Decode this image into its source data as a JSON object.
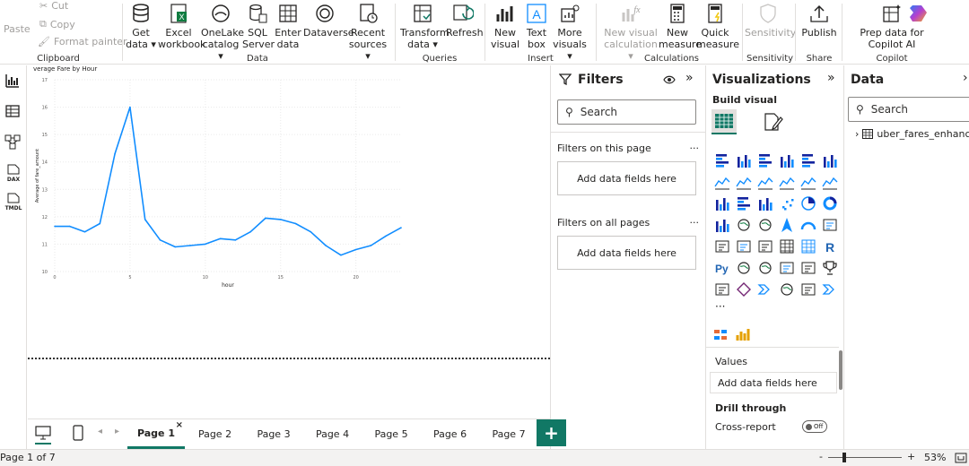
{
  "ribbon": {
    "clipboard": {
      "paste": "Paste",
      "cut": "Cut",
      "copy": "Copy",
      "format_painter": "Format painter",
      "group": "Clipboard"
    },
    "data": {
      "get_data": "Get data",
      "excel": "Excel workbook",
      "onelake": "OneLake catalog",
      "sql": "SQL Server",
      "enter": "Enter data",
      "dataverse": "Dataverse",
      "recent": "Recent sources",
      "group": "Data"
    },
    "queries": {
      "transform": "Transform data",
      "refresh": "Refresh",
      "group": "Queries"
    },
    "insert": {
      "new_visual": "New visual",
      "text_box": "Text box",
      "more_visuals": "More visuals",
      "group": "Insert"
    },
    "calculations": {
      "new_visual_calc": "New visual calculation",
      "new_measure": "New measure",
      "quick_measure": "Quick measure",
      "group": "Calculations"
    },
    "sensitivity": {
      "label": "Sensitivity",
      "group": "Sensitivity"
    },
    "share": {
      "publish": "Publish",
      "group": "Share"
    },
    "copilot": {
      "prep": "Prep data for Copilot AI",
      "group": "Copilot"
    }
  },
  "leftnav": {
    "dax": "DAX",
    "tmdl": "TMDL"
  },
  "visual": {
    "title": "verage Fare by Hour",
    "xlabel": "hour",
    "ylabel": "Average of fare_amount"
  },
  "chart_data": {
    "type": "line",
    "title": "verage Fare by Hour",
    "xlabel": "hour",
    "ylabel": "Average of fare_amount",
    "xlim": [
      0,
      23
    ],
    "ylim": [
      10,
      17
    ],
    "x_ticks": [
      "0",
      "5",
      "10",
      "15",
      "20"
    ],
    "y_ticks": [
      "10",
      "11",
      "12",
      "13",
      "14",
      "15",
      "16",
      "17"
    ],
    "x": [
      0,
      1,
      2,
      3,
      4,
      5,
      6,
      7,
      8,
      9,
      10,
      11,
      12,
      13,
      14,
      15,
      16,
      17,
      18,
      19,
      20,
      21,
      22,
      23
    ],
    "series": [
      {
        "values": [
          11.65,
          11.65,
          11.45,
          11.75,
          14.3,
          16.0,
          11.9,
          11.15,
          10.9,
          10.95,
          11.0,
          11.2,
          11.15,
          11.45,
          11.95,
          11.9,
          11.75,
          11.45,
          10.95,
          10.6,
          10.8,
          10.95,
          11.3,
          11.6
        ],
        "color": "#118dff"
      }
    ],
    "grid": true
  },
  "filters": {
    "title": "Filters",
    "search": "Search",
    "on_page": "Filters on this page",
    "all_pages": "Filters on all pages",
    "drop": "Add data fields here",
    "more": "···"
  },
  "viz": {
    "title": "Visualizations",
    "build": "Build visual",
    "more": "···",
    "values": "Values",
    "drop": "Add data fields here",
    "drill": "Drill through",
    "cross": "Cross-report",
    "toggle": "Off"
  },
  "datapane": {
    "title": "Data",
    "search": "Search",
    "table": "uber_fares_enhanced"
  },
  "tabs": {
    "pages": [
      "Page 1",
      "Page 2",
      "Page 3",
      "Page 4",
      "Page 5",
      "Page 6",
      "Page 7"
    ],
    "close": "×",
    "add": "+"
  },
  "status": {
    "page": "Page 1 of 7",
    "zoom": "53%",
    "minus": "-",
    "plus": "+"
  }
}
